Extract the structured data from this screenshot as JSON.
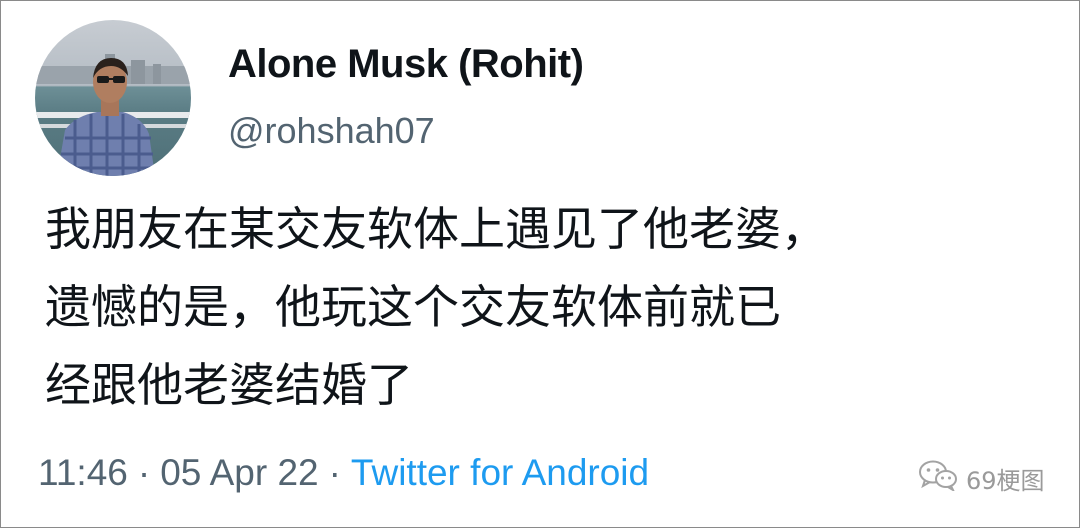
{
  "user": {
    "display_name": "Alone Musk (Rohit)",
    "handle": "@rohshah07"
  },
  "tweet": {
    "lines": [
      "我朋友在某交友软体上遇见了他老婆，",
      "遗憾的是，他玩这个交友软体前就已",
      "经跟他老婆结婚了"
    ]
  },
  "meta": {
    "time": "11:46",
    "separator": "·",
    "date": "05 Apr 22",
    "source": "Twitter for Android"
  },
  "watermark": {
    "text": "69梗图",
    "icon": "wechat-logo-icon"
  },
  "colors": {
    "text": "#0f1419",
    "secondary": "#536471",
    "link": "#1d9bf0"
  }
}
